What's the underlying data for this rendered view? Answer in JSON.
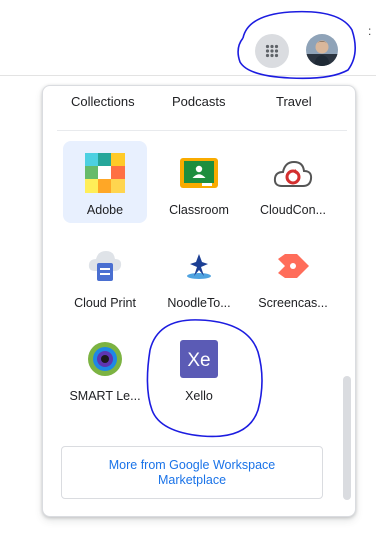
{
  "header": {
    "edge_char": ":",
    "apps_button_icon": "apps-grid-icon",
    "account_icon": "account-avatar"
  },
  "launcher": {
    "categories": [
      "Collections",
      "Podcasts",
      "Travel"
    ],
    "apps": [
      {
        "label": "Adobe",
        "icon": "adobe-icon"
      },
      {
        "label": "Classroom",
        "icon": "classroom-icon"
      },
      {
        "label": "CloudCon...",
        "icon": "cloudconvert-icon"
      },
      {
        "label": "Cloud Print",
        "icon": "cloud-print-icon"
      },
      {
        "label": "NoodleTo...",
        "icon": "noodletools-icon"
      },
      {
        "label": "Screencas...",
        "icon": "screencastify-icon"
      },
      {
        "label": "SMART Le...",
        "icon": "smart-learning-icon"
      },
      {
        "label": "Xello",
        "icon": "xello-icon",
        "icon_text": "Xe"
      }
    ],
    "more_button": "More from Google Workspace Marketplace"
  },
  "colors": {
    "annotation": "#1c1ce0",
    "link_blue": "#1a73e8",
    "selected_bg": "#e8f0fe",
    "xello": "#5b5bb5"
  }
}
